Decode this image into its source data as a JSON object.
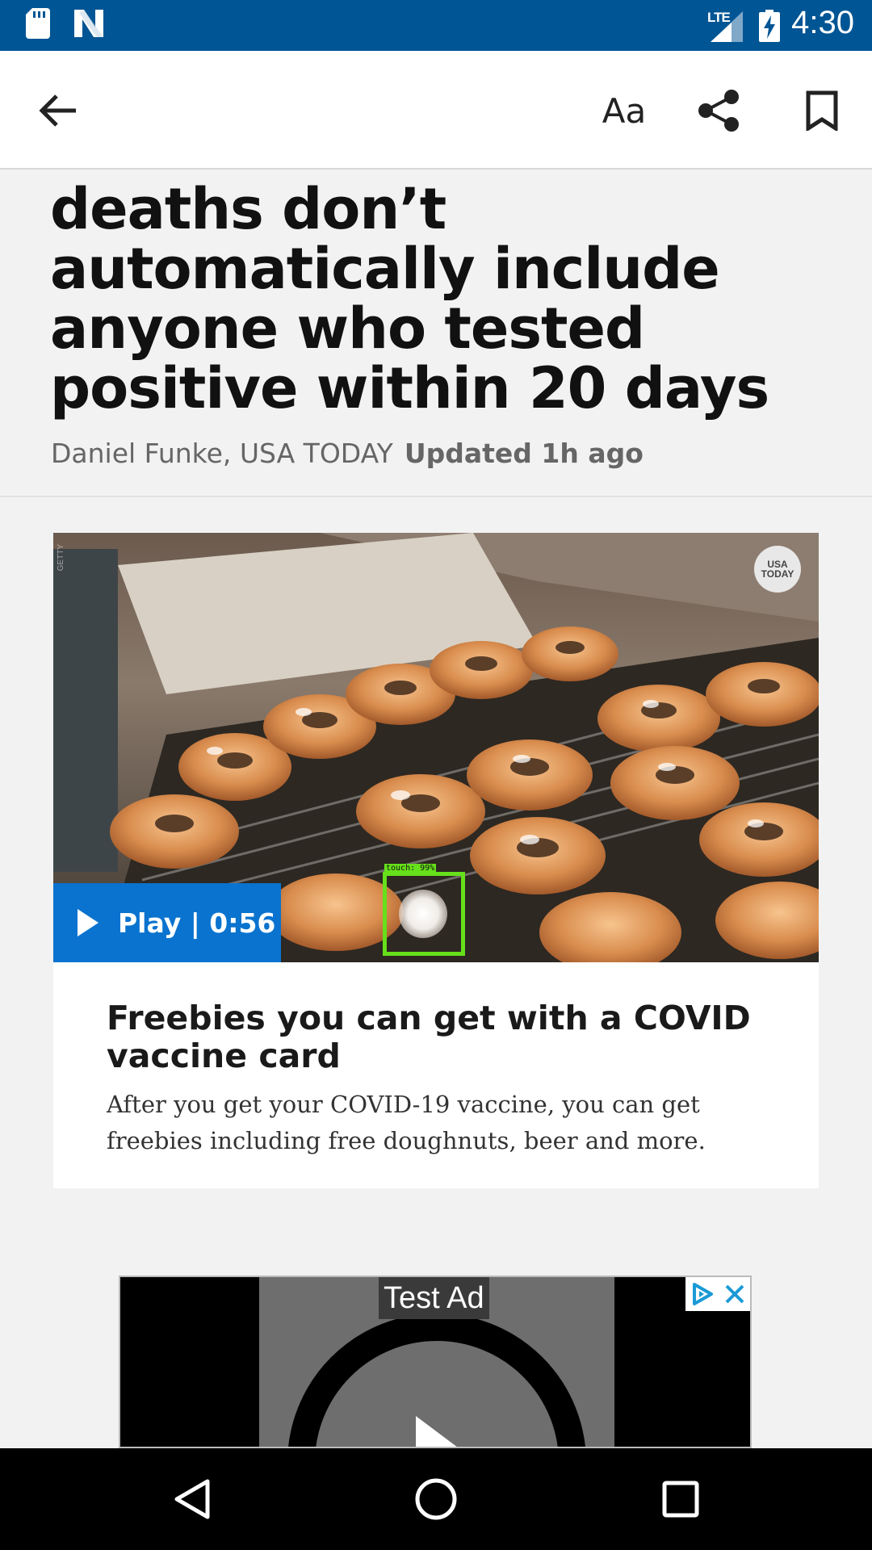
{
  "status_bar": {
    "time": "4:30",
    "network": "LTE",
    "icons": [
      "sd-card-icon",
      "n-notification-icon",
      "lte-signal-icon",
      "battery-charging-icon"
    ]
  },
  "app_bar": {
    "icons": [
      "back-arrow-icon",
      "text-size-icon",
      "share-icon",
      "bookmark-icon"
    ],
    "text_size_label": "Aa"
  },
  "article": {
    "headline": "deaths don’t automatically include anyone who tested positive within 20 days",
    "author": "Daniel Funke, USA TODAY",
    "updated": "Updated 1h ago"
  },
  "video": {
    "play_label": "Play | 0:56",
    "badge_text": "USA TODAY",
    "credit": "GETTY",
    "touch_overlay_label": "touch: 99%",
    "title": "Freebies you can get with a COVID vaccine card",
    "description": "After you get your COVID-19 vaccine, you can get freebies including free doughnuts, beer and more."
  },
  "ad": {
    "label": "Test Ad",
    "icons": [
      "adchoices-icon",
      "close-icon"
    ]
  },
  "nav_bar": {
    "icons": [
      "nav-back-icon",
      "nav-home-icon",
      "nav-recents-icon"
    ]
  },
  "colors": {
    "status_bar": "#005594",
    "play_button": "#0a73cf",
    "touch_box": "#66e01a"
  }
}
